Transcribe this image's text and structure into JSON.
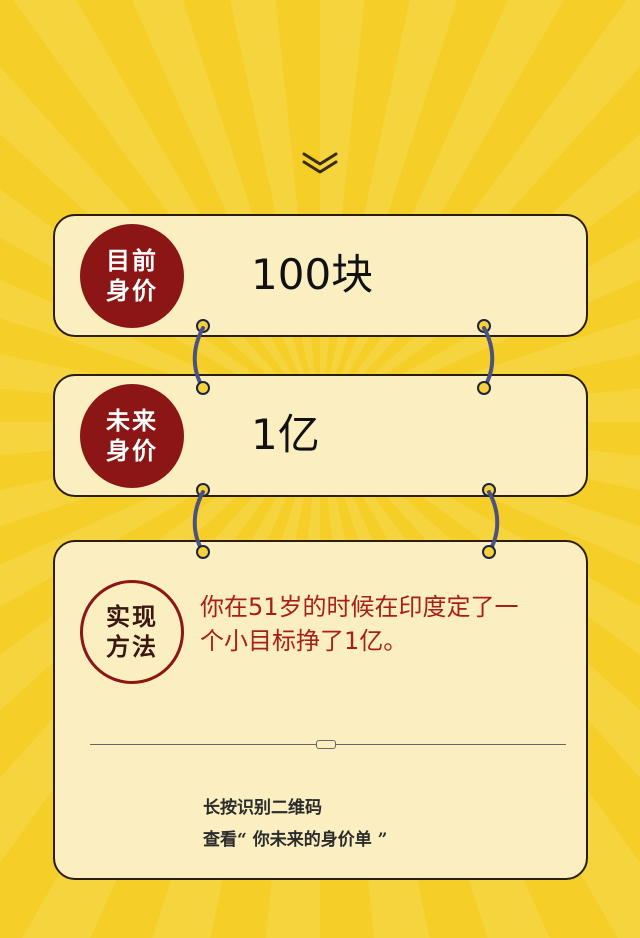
{
  "colors": {
    "background": "#f5cf28",
    "card": "#fbefc1",
    "badge": "#8c1515",
    "accent_text": "#a81f16"
  },
  "current_worth": {
    "badge_label": "目前身价",
    "value": "100块"
  },
  "future_worth": {
    "badge_label": "未来身价",
    "value": "1亿"
  },
  "method": {
    "badge_label": "实现方法",
    "text": "你在51岁的时候在印度定了一个小目标挣了1亿。"
  },
  "footer": {
    "line1": "长按识别二维码",
    "line2": "查看“ 你未来的身价单 ”"
  },
  "icons": {
    "scroll_down": "double-chevron-down-icon",
    "ring": "binder-ring-icon"
  }
}
